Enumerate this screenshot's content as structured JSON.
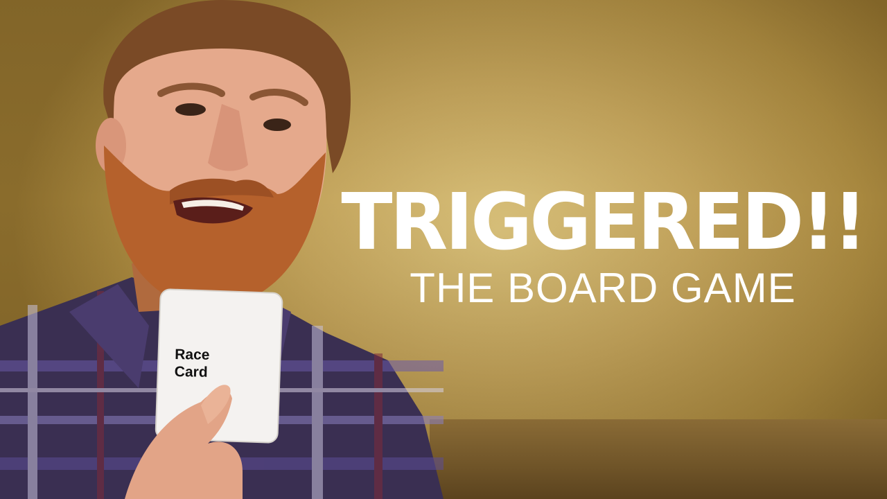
{
  "title": {
    "main": "TRIGGERED!!",
    "sub": "THE BOARD GAME"
  },
  "card": {
    "line1": "Race",
    "line2": "Card"
  },
  "colors": {
    "wall": "#c3a45c",
    "title_text": "#ffffff",
    "card": "#f4f2f0"
  }
}
